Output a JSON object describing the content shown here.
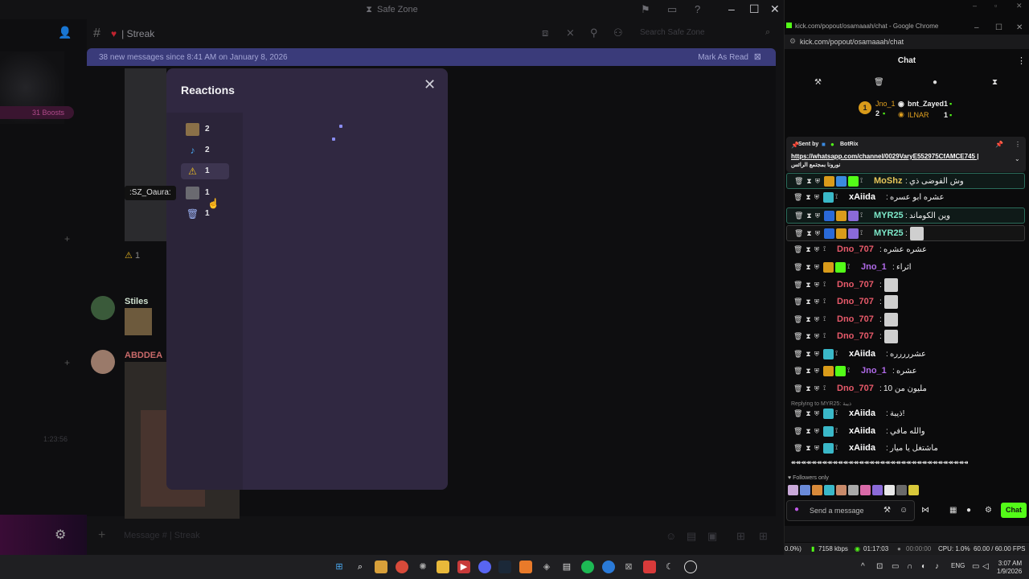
{
  "discord": {
    "window_title": "Safe Zone",
    "channel_name": "| Streak",
    "search_placeholder": "Search Safe Zone",
    "new_messages_text": "38 new messages since 8:41 AM on January 8, 2026",
    "mark_as_read": "Mark As Read",
    "boosts_label": "31 Boosts",
    "tooltip_text": ":SZ_Oaura:",
    "rail_time": "1:23:56",
    "message_placeholder": "Message # | Streak",
    "reaction_strip_count": "1",
    "author1": "Stiles",
    "author2": "ABDDEA"
  },
  "reactions_modal": {
    "title": "Reactions",
    "items": [
      {
        "count": "2",
        "icon": "cat-emoji-icon"
      },
      {
        "count": "2",
        "icon": "blue-figure-icon"
      },
      {
        "count": "1",
        "icon": "warning-icon",
        "selected": true
      },
      {
        "count": "1",
        "icon": "car-emoji-icon"
      },
      {
        "count": "1",
        "icon": "trash-icon"
      }
    ]
  },
  "chrome": {
    "tab_title": "kick.com/popout/osamaaah/chat - Google Chrome",
    "url": "kick.com/popout/osamaaah/chat"
  },
  "kick": {
    "chat_title": "Chat",
    "leaderboard": {
      "top_name": "Jno_1",
      "top_count": "2",
      "second_name": "bnt_Zayed",
      "second_count": "1",
      "third_name": "ILNAR",
      "third_count": "1",
      "rank": "1"
    },
    "pinned": {
      "sent_by": "Sent by",
      "bot_name": "BotRix",
      "link": "https://whatsapp.com/channel/0029VaryE552975CfAMCE745 |",
      "text": "نورونا بمجتمع الرائس"
    },
    "messages": [
      {
        "user": "MoShz",
        "text": "وش الفوضى ذي",
        "color": "#e8c75a"
      },
      {
        "user": "xAiida",
        "text": "عشره ابو عسره",
        "color": "#ffffff"
      },
      {
        "user": "MYR25",
        "text": "وين الكوماند",
        "color": "#7de8c9"
      },
      {
        "user": "MYR25",
        "text": "",
        "color": "#7de8c9"
      },
      {
        "user": "Dno_707",
        "text": "عشره عشره",
        "color": "#e85a6a"
      },
      {
        "user": "Jno_1",
        "text": "اثراء",
        "color": "#b06ae8"
      },
      {
        "user": "Dno_707",
        "text": "",
        "color": "#e85a6a"
      },
      {
        "user": "Dno_707",
        "text": "",
        "color": "#e85a6a"
      },
      {
        "user": "Dno_707",
        "text": "",
        "color": "#e85a6a"
      },
      {
        "user": "Dno_707",
        "text": "",
        "color": "#e85a6a"
      },
      {
        "user": "xAiida",
        "text": "عشررررره",
        "color": "#ffffff"
      },
      {
        "user": "Jno_1",
        "text": "عشره",
        "color": "#b06ae8"
      },
      {
        "user": "Dno_707",
        "text": "مليون من 10",
        "color": "#e85a6a"
      },
      {
        "user": "xAiida",
        "text": "ذيبة!",
        "color": "#ffffff"
      },
      {
        "user": "xAiida",
        "text": "والله مافي",
        "color": "#ffffff"
      },
      {
        "user": "xAiida",
        "text": "ماشتغل يا ميار",
        "color": "#ffffff"
      }
    ],
    "reply_to": "Replying to MYR25: ذيبة",
    "arrows": "↞↞↞↞↞↞↞↞↞↞↞↞↞↞↞↞↞↞↞↞↞↞↞↞↞↞↞↞↞↞↞↞↞↞↞↞",
    "followers_only": "Followers only",
    "send_placeholder": "Send a message",
    "chat_button": "Chat"
  },
  "obs": {
    "dropped": "0.0%)",
    "bitrate": "7158 kbps",
    "live_time": "01:17:03",
    "rec_time": "00:00:00",
    "cpu": "CPU: 1.0%",
    "fps": "60.00 / 60.00 FPS"
  },
  "taskbar": {
    "lang": "ENG",
    "time": "3:07 AM",
    "date": "1/9/2026"
  },
  "colors": {
    "kick_green": "#53fc18",
    "modal_bg": "#302841",
    "discord_bg": "#121214",
    "newbar_bg": "#3a3b7a"
  }
}
